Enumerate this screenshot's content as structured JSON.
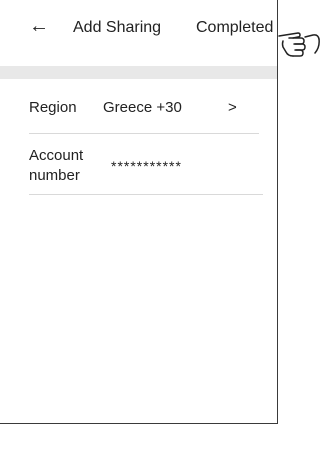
{
  "header": {
    "back_icon": "back-arrow-icon",
    "back_glyph": "←",
    "title": "Add Sharing",
    "action_label": "Completed"
  },
  "form": {
    "region_label": "Region",
    "region_value": "Greece +30",
    "region_chevron": ">",
    "account_label": "Account number",
    "account_value": "***********"
  },
  "annotation": {
    "icon": "pointing-hand-icon"
  },
  "colors": {
    "background": "#ffffff",
    "band": "#e8e8e8",
    "divider": "#d9d9d9",
    "text": "#1f1f1f"
  }
}
